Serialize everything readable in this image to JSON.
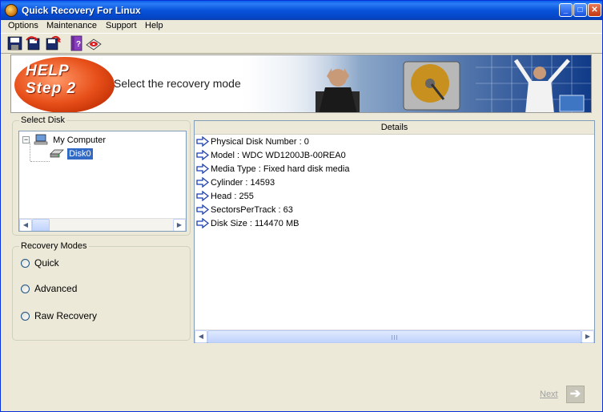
{
  "window": {
    "title": "Quick Recovery For Linux",
    "controls": [
      "minimize",
      "maximize",
      "close"
    ]
  },
  "menu": {
    "items": [
      "Options",
      "Maintenance",
      "Support",
      "Help"
    ]
  },
  "toolbar": {
    "icons": [
      "save-icon",
      "recover-icon",
      "transfer-icon",
      "help-book-icon",
      "disk-icon"
    ]
  },
  "banner": {
    "help_word": "HELP",
    "step_word": "Step 2",
    "caption": "Select the recovery mode",
    "colors": {
      "help_orange": "#E8501A",
      "photo_blue": "#1F4F9C"
    }
  },
  "select_disk": {
    "group_label": "Select Disk",
    "tree": {
      "root_label": "My Computer",
      "child_label": "Disk0",
      "expander": "−"
    }
  },
  "recovery_modes": {
    "group_label": "Recovery Modes",
    "options": [
      "Quick",
      "Advanced",
      "Raw Recovery"
    ]
  },
  "details": {
    "header": "Details",
    "rows": [
      "Physical Disk Number : 0",
      "Model   : WDC WD1200JB-00REA0",
      "Media Type   : Fixed hard disk media",
      "Cylinder   : 14593",
      "Head   : 255",
      "SectorsPerTrack   : 63",
      "Disk Size  : 114470 MB"
    ]
  },
  "footer": {
    "next_label": "Next",
    "next_arrow": "➔"
  }
}
